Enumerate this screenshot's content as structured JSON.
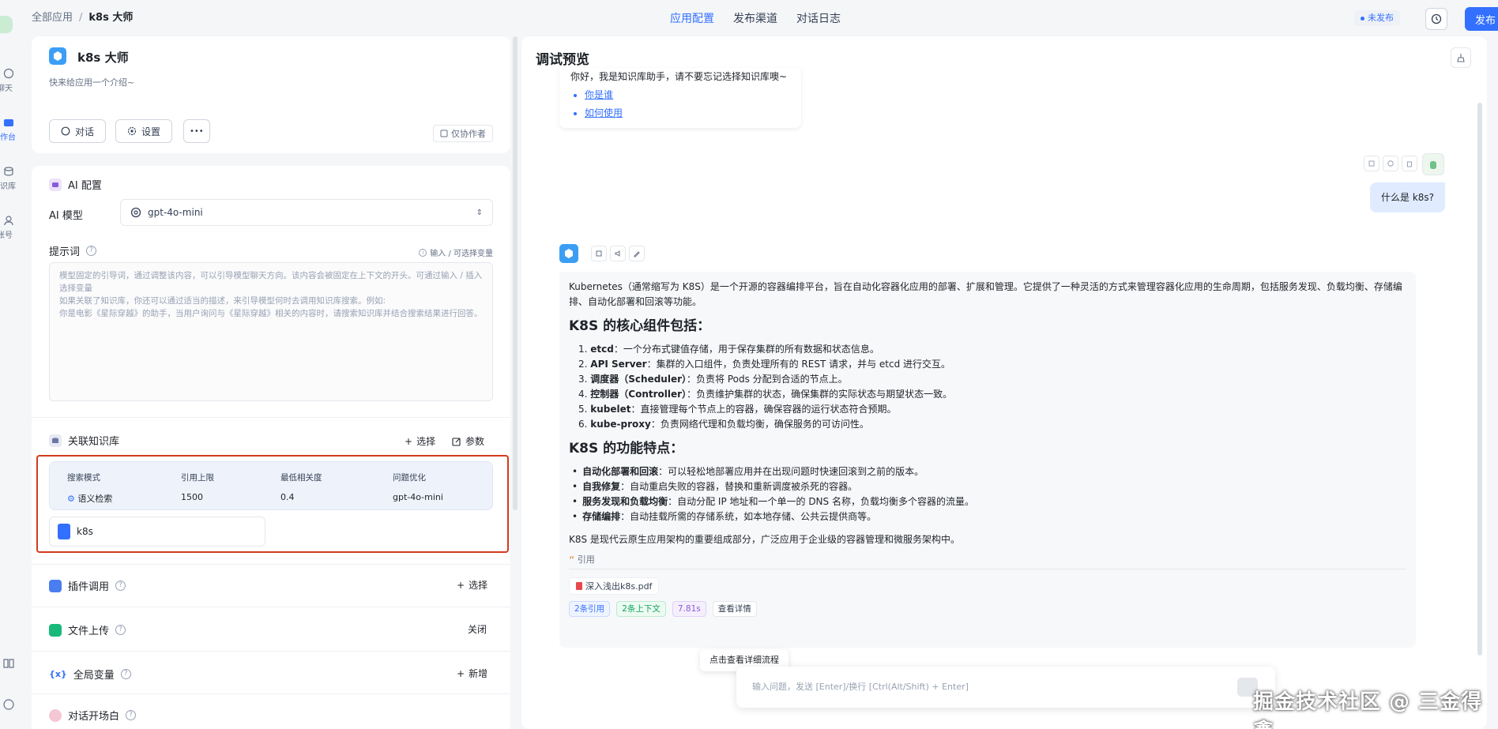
{
  "rail": {
    "items": [
      {
        "label": "聊天"
      },
      {
        "label": "工作台"
      },
      {
        "label": "知识库"
      },
      {
        "label": "账号"
      }
    ]
  },
  "topbar": {
    "breadcrumb_root": "全部应用",
    "breadcrumb_sep": "/",
    "breadcrumb_current": "k8s 大师",
    "tabs": [
      "应用配置",
      "发布渠道",
      "对话日志"
    ],
    "status": "未发布",
    "publish_label": "发布"
  },
  "app": {
    "name": "k8s 大师",
    "description": "快来给应用一个介绍~",
    "chat_button": "对话",
    "settings_button": "设置",
    "more_button": "•••",
    "author_only": "仅协作者"
  },
  "ai_config": {
    "section_title": "AI 配置",
    "model_label": "AI 模型",
    "model_value": "gpt-4o-mini",
    "prompt_label": "提示词",
    "var_hint": "输入 / 可选择变量",
    "prompt_placeholder": "模型固定的引导词，通过调整该内容，可以引导模型聊天方向。该内容会被固定在上下文的开头。可通过输入 / 插入选择变量\n如果关联了知识库，你还可以通过适当的描述，来引导模型何时去调用知识库搜索。例如:\n你是电影《星际穿越》的助手，当用户询问与《星际穿越》相关的内容时，请搜索知识库并结合搜索结果进行回答。"
  },
  "knowledge": {
    "section_title": "关联知识库",
    "select_label": "选择",
    "params_label": "参数",
    "headers": [
      "搜索模式",
      "引用上限",
      "最低相关度",
      "问题优化"
    ],
    "row": [
      "语义检索",
      "1500",
      "0.4",
      "gpt-4o-mini"
    ],
    "dataset_name": "k8s"
  },
  "sections": {
    "plugin": {
      "title": "插件调用",
      "action": "选择"
    },
    "file_upload": {
      "title": "文件上传",
      "action": "关闭"
    },
    "variables": {
      "title": "全局变量",
      "action": "新增"
    },
    "opening": {
      "title": "对话开场白"
    }
  },
  "preview": {
    "title": "调试预览",
    "welcome_text": "你好，我是知识库助手，请不要忘记选择知识库噢~",
    "welcome_links": [
      "你是谁",
      "如何使用"
    ],
    "user_message": "什么是 k8s?",
    "answer_intro": "Kubernetes（通常缩写为 K8S）是一个开源的容器编排平台，旨在自动化容器化应用的部署、扩展和管理。它提供了一种灵活的方式来管理容器化应用的生命周期，包括服务发现、负载均衡、存储编排、自动化部署和回滚等功能。",
    "heading1": "K8S 的核心组件包括：",
    "components": [
      {
        "num": "1.",
        "name": "etcd",
        "desc": "：一个分布式键值存储，用于保存集群的所有数据和状态信息。"
      },
      {
        "num": "2.",
        "name": "API Server",
        "desc": "：集群的入口组件，负责处理所有的 REST 请求，并与 etcd 进行交互。"
      },
      {
        "num": "3.",
        "name": "调度器（Scheduler）",
        "desc": "：负责将 Pods 分配到合适的节点上。"
      },
      {
        "num": "4.",
        "name": "控制器（Controller）",
        "desc": "：负责维护集群的状态，确保集群的实际状态与期望状态一致。"
      },
      {
        "num": "5.",
        "name": "kubelet",
        "desc": "：直接管理每个节点上的容器，确保容器的运行状态符合预期。"
      },
      {
        "num": "6.",
        "name": "kube-proxy",
        "desc": "：负责网络代理和负载均衡，确保服务的可访问性。"
      }
    ],
    "heading2": "K8S 的功能特点：",
    "features": [
      {
        "name": "自动化部署和回滚",
        "desc": "：可以轻松地部署应用并在出现问题时快速回滚到之前的版本。"
      },
      {
        "name": "自我修复",
        "desc": "：自动重启失败的容器，替换和重新调度被杀死的容器。"
      },
      {
        "name": "服务发现和负载均衡",
        "desc": "：自动分配 IP 地址和一个单一的 DNS 名称，负载均衡多个容器的流量。"
      },
      {
        "name": "存储编排",
        "desc": "：自动挂载所需的存储系统，如本地存储、公共云提供商等。"
      }
    ],
    "summary": "K8S 是现代云原生应用架构的重要组成部分，广泛应用于企业级的容器管理和微服务架构中。",
    "cite_label": "引用",
    "cite_file": "深入浅出k8s.pdf",
    "tags": [
      "2条引用",
      "2条上下文",
      "7.81s",
      "查看详情"
    ],
    "flow_tip": "点击查看详细流程",
    "input_placeholder": "输入问题，发送 [Enter]/换行 [Ctrl(Alt/Shift) + Enter]"
  },
  "watermark": "掘金技术社区 @ 三金得鑫",
  "colors": {
    "accent": "#3370ff",
    "highlight_border": "#d23b1d"
  }
}
